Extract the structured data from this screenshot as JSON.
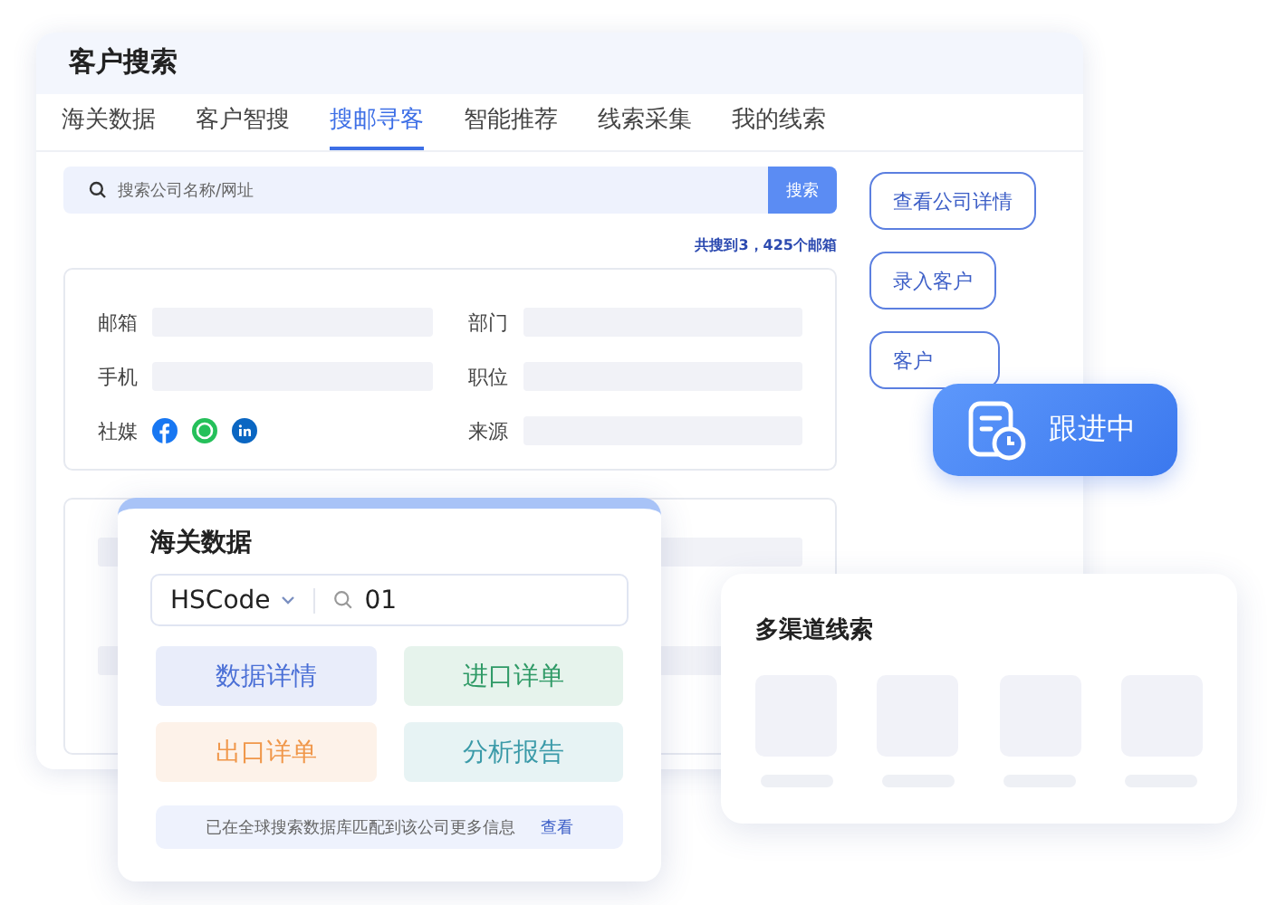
{
  "window": {
    "title": "客户搜索"
  },
  "tabs": [
    {
      "label": "海关数据",
      "selected": false
    },
    {
      "label": "客户智搜",
      "selected": false
    },
    {
      "label": "搜邮寻客",
      "selected": true
    },
    {
      "label": "智能推荐",
      "selected": false
    },
    {
      "label": "线索采集",
      "selected": false
    },
    {
      "label": "我的线索",
      "selected": false
    }
  ],
  "search": {
    "placeholder": "搜索公司名称/网址",
    "button": "搜索"
  },
  "result_count": "共搜到3，425个邮箱",
  "contact_card": {
    "left_fields": [
      "邮箱",
      "手机"
    ],
    "social_label": "社媒",
    "right_fields": [
      "部门",
      "职位",
      "来源"
    ]
  },
  "actions": [
    "查看公司详情",
    "录入客户",
    "客户"
  ],
  "status_badge": {
    "label": "跟进中"
  },
  "customs_popup": {
    "title": "海关数据",
    "code_type": "HSCode",
    "query": "01",
    "tiles": [
      {
        "label": "数据详情",
        "color": "#4a6fd6"
      },
      {
        "label": "进口详单",
        "color": "#2f9a66"
      },
      {
        "label": "出口详单",
        "color": "#f0974a"
      },
      {
        "label": "分析报告",
        "color": "#3a9aa8"
      }
    ],
    "notice": "已在全球搜索数据库匹配到该公司更多信息",
    "link": "查看"
  },
  "channels_card": {
    "title": "多渠道线索"
  }
}
